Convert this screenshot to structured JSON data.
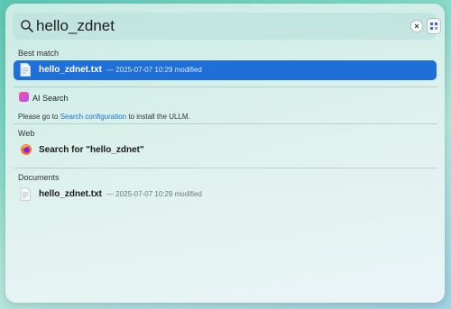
{
  "search": {
    "query": "hello_zdnet"
  },
  "sections": {
    "best_match": "Best match",
    "ai_search": "AI Search",
    "web": "Web",
    "documents": "Documents"
  },
  "best_match_item": {
    "name": "hello_zdnet.txt",
    "meta": "— 2025-07-07 10:29 modified"
  },
  "ai_note": {
    "prefix": "Please go to",
    "link": "Search configuration",
    "suffix": "to install the ULLM."
  },
  "web_item": {
    "label": "Search for \"hello_zdnet\""
  },
  "document_item": {
    "name": "hello_zdnet.txt",
    "meta": "— 2025-07-07 10:29 modified"
  },
  "colors": {
    "accent": "#1f6fd8",
    "selected_text": "#ffffff"
  }
}
